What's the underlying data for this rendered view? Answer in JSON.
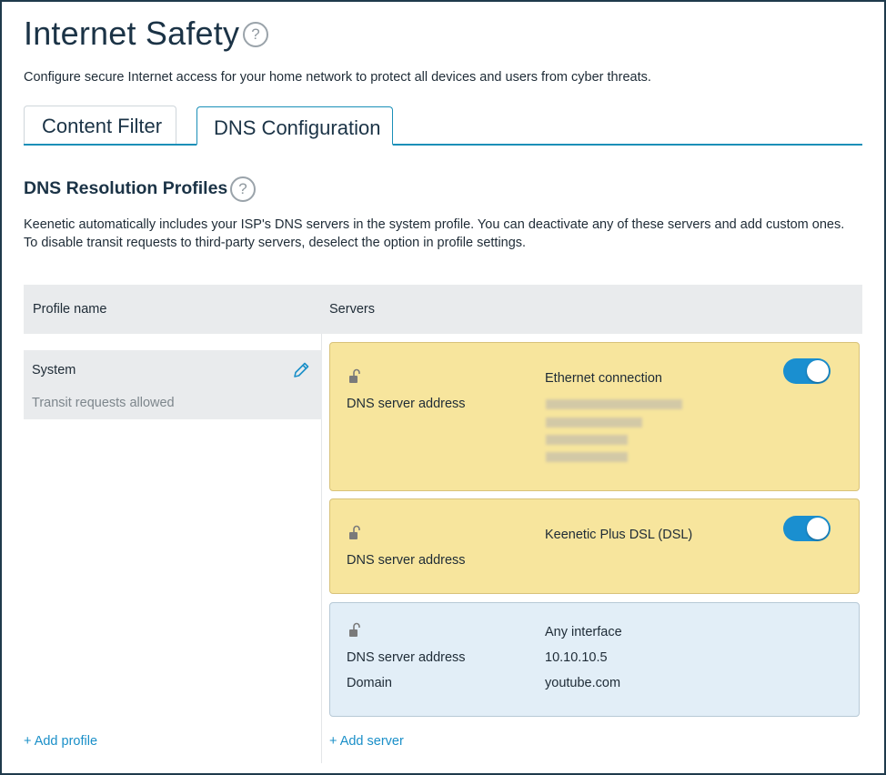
{
  "page": {
    "title": "Internet Safety",
    "help_glyph": "?",
    "intro": "Configure secure Internet access for your home network to protect all devices and users from cyber threats."
  },
  "tabs": [
    {
      "label": "Content Filter",
      "active": false
    },
    {
      "label": "DNS Configuration",
      "active": true
    }
  ],
  "section": {
    "title": "DNS Resolution Profiles",
    "description_line1": "Keenetic automatically includes your ISP's DNS servers in the system profile. You can deactivate any of these servers and add custom ones.",
    "description_line2": "To disable transit requests to third-party servers, deselect the option in profile settings."
  },
  "table": {
    "col_profile": "Profile name",
    "col_servers": "Servers"
  },
  "profiles": [
    {
      "name": "System",
      "status": "Transit requests allowed"
    }
  ],
  "servers": [
    {
      "interface": "Ethernet connection",
      "address_label": "DNS server address",
      "enabled": true,
      "addresses_obscured": true
    },
    {
      "interface": "Keenetic Plus DSL (DSL)",
      "address_label": "DNS server address",
      "enabled": true
    },
    {
      "interface": "Any interface",
      "address_label": "DNS server address",
      "address": "10.10.10.5",
      "domain_label": "Domain",
      "domain": "youtube.com"
    }
  ],
  "actions": {
    "add_profile": "+ Add profile",
    "add_server": "+ Add server"
  },
  "colors": {
    "accent": "#1a8fc8",
    "toggle_on": "#1a8fd0",
    "isp_card": "#f7e59d",
    "custom_card": "#e2eef7",
    "title": "#1b3346"
  },
  "icons": {
    "help": "question-circle-icon",
    "edit": "pencil-icon",
    "lock": "unlocked-padlock-icon"
  }
}
